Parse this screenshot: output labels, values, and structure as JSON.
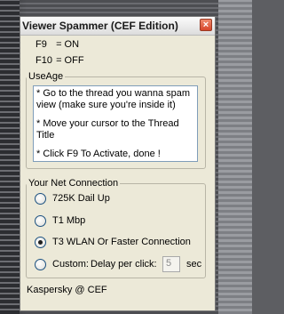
{
  "window": {
    "title": "Viewer Spammer (CEF Edition)",
    "close_symbol": "×",
    "close_icon": "close-icon"
  },
  "status": {
    "f9_key": "F9",
    "f9_value": "= ON",
    "f10_key": "F10",
    "f10_value": "= OFF"
  },
  "usage": {
    "legend": "UseAge",
    "lines": [
      "* Go to the thread you wanna spam view (make sure you're inside it)",
      "* Move your cursor to the Thread Title",
      "* Click F9 To Activate, done !"
    ]
  },
  "connection": {
    "legend": "Your Net Connection",
    "options": [
      {
        "label": "725K Dail Up",
        "checked": false
      },
      {
        "label": "T1 Mbp",
        "checked": false
      },
      {
        "label": "T3 WLAN Or Faster Connection",
        "checked": true
      },
      {
        "label": "Custom:",
        "checked": false
      }
    ],
    "delay_label": "Delay per click:",
    "delay_value": "5",
    "delay_unit": "sec"
  },
  "footer": {
    "text": "Kaspersky @ CEF"
  },
  "colors": {
    "window_bg": "#ece9d8",
    "close_button": "#d8462a",
    "group_border": "#b8b5a6"
  }
}
